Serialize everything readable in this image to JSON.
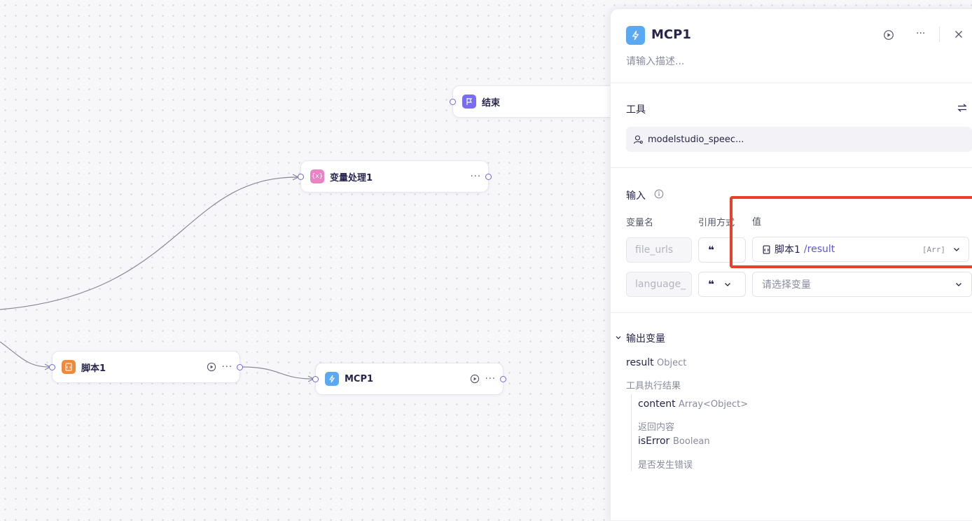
{
  "canvas": {
    "nodes": {
      "end": {
        "title": "结束"
      },
      "var": {
        "title": "变量处理1"
      },
      "script": {
        "title": "脚本1"
      },
      "mcp": {
        "title": "MCP1"
      }
    },
    "colors": {
      "end": "#7b6cf6",
      "var": "#e884c3",
      "script": "#ef8a3a",
      "mcp": "#5aa9f2",
      "edge": "#8a8a99",
      "port": "#6b6bd6"
    }
  },
  "panel": {
    "title": "MCP1",
    "description_placeholder": "请输入描述...",
    "tool_section_label": "工具",
    "tool_name": "modelstudio_speec...",
    "input_section_label": "输入",
    "columns": {
      "name": "变量名",
      "ref": "引用方式",
      "value": "值"
    },
    "rows": [
      {
        "name": "file_urls",
        "ref_icon": "quote-icon",
        "value_source": "脚本1",
        "value_path": "/result",
        "value_type": "[Arr]"
      },
      {
        "name": "language_",
        "ref_icon": "quote-icon",
        "value_placeholder": "请选择变量"
      }
    ],
    "output_section_label": "输出变量",
    "outputs": {
      "result": {
        "name": "result",
        "type": "Object",
        "desc": "工具执行结果"
      },
      "content": {
        "name": "content",
        "type": "Array<Object>",
        "desc": "返回内容"
      },
      "isError": {
        "name": "isError",
        "type": "Boolean",
        "desc": "是否发生错误"
      }
    },
    "highlight_color": "#e8412b"
  }
}
